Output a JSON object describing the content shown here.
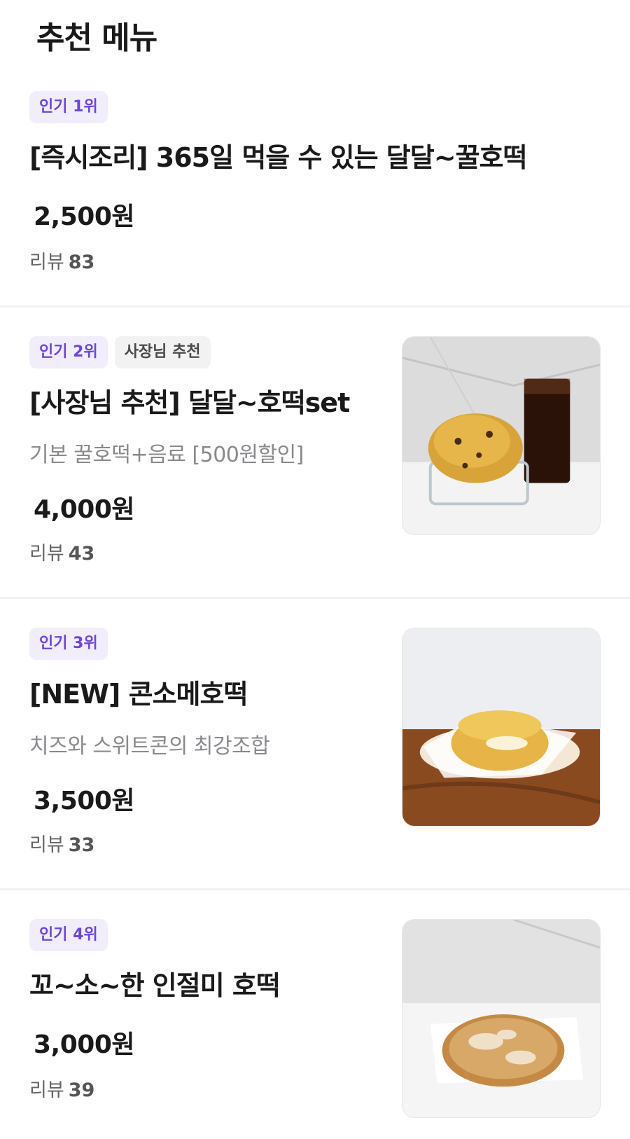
{
  "header": {
    "title": "추천 메뉴"
  },
  "review_label": "리뷰",
  "items": [
    {
      "badges": [
        "인기 1위"
      ],
      "name": "[즉시조리] 365일 먹을 수 있는 달달~꿀호떡",
      "description": "",
      "price": "2,500원",
      "reviews": "83"
    },
    {
      "badges": [
        "인기 2위",
        "사장님 추천"
      ],
      "name": "[사장님 추천] 달달~호떡set",
      "description": "기본 꿀호떡+음료 [500원할인]",
      "price": "4,000원",
      "reviews": "43",
      "image": "hotteok-with-iced-coffee"
    },
    {
      "badges": [
        "인기 3위"
      ],
      "name": "[NEW] 콘소메호떡",
      "description": "치즈와 스위트콘의 최강조합",
      "price": "3,500원",
      "reviews": "33",
      "image": "corn-cheese-hotteok-on-plate"
    },
    {
      "badges": [
        "인기 4위"
      ],
      "name": "꼬~소~한 인절미 호떡",
      "description": "",
      "price": "3,000원",
      "reviews": "39",
      "image": "injeolmi-hotteok"
    }
  ],
  "colors": {
    "badge_popular_bg": "#f1edfb",
    "badge_popular_text": "#6b47d6",
    "price": "#1a1a1a"
  }
}
